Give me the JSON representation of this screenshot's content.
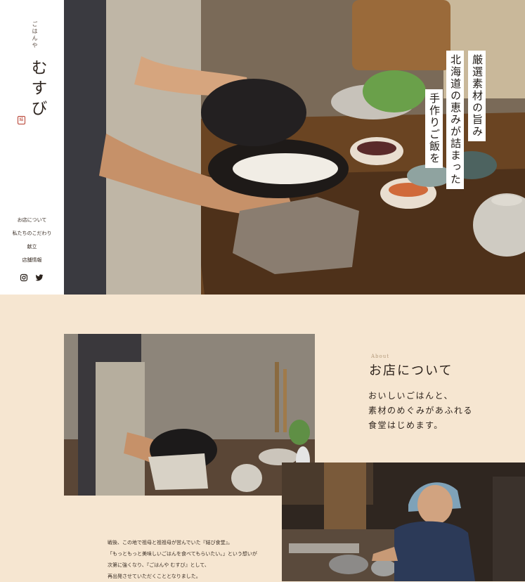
{
  "brand": {
    "sub": "ごはんや",
    "name": "むすび",
    "seal": "結",
    "seal_color": "#b53a2a"
  },
  "nav": {
    "items": [
      {
        "label": "お店について"
      },
      {
        "label": "私たちのこだわり"
      },
      {
        "label": "献立"
      },
      {
        "label": "店舗情報"
      }
    ],
    "social": [
      {
        "icon": "instagram-icon"
      },
      {
        "icon": "twitter-icon"
      }
    ]
  },
  "hero": {
    "lines": [
      "厳選素材の旨み",
      "北海道の恵みが詰まった",
      "手作りご飯を"
    ]
  },
  "about": {
    "label": "About",
    "title": "お店について",
    "lead": [
      "おいしいごはんと、",
      "素材のめぐみがあふれる",
      "食堂はじめます。"
    ],
    "story": [
      "戦後、この地で祖母と祖祖母が営んでいた『結び食堂』。",
      "「もっともっと美味しいごはんを食べてもらいたい。」という想いが",
      "次第に強くなり、『ごはんや むすび』として、",
      "再出発させていただくこととなりました。"
    ]
  },
  "colors": {
    "page_bg": "#f6e6d1",
    "sidebar_bg": "#ffffff",
    "text": "#3a2e25",
    "about_label": "#b49a7b"
  }
}
